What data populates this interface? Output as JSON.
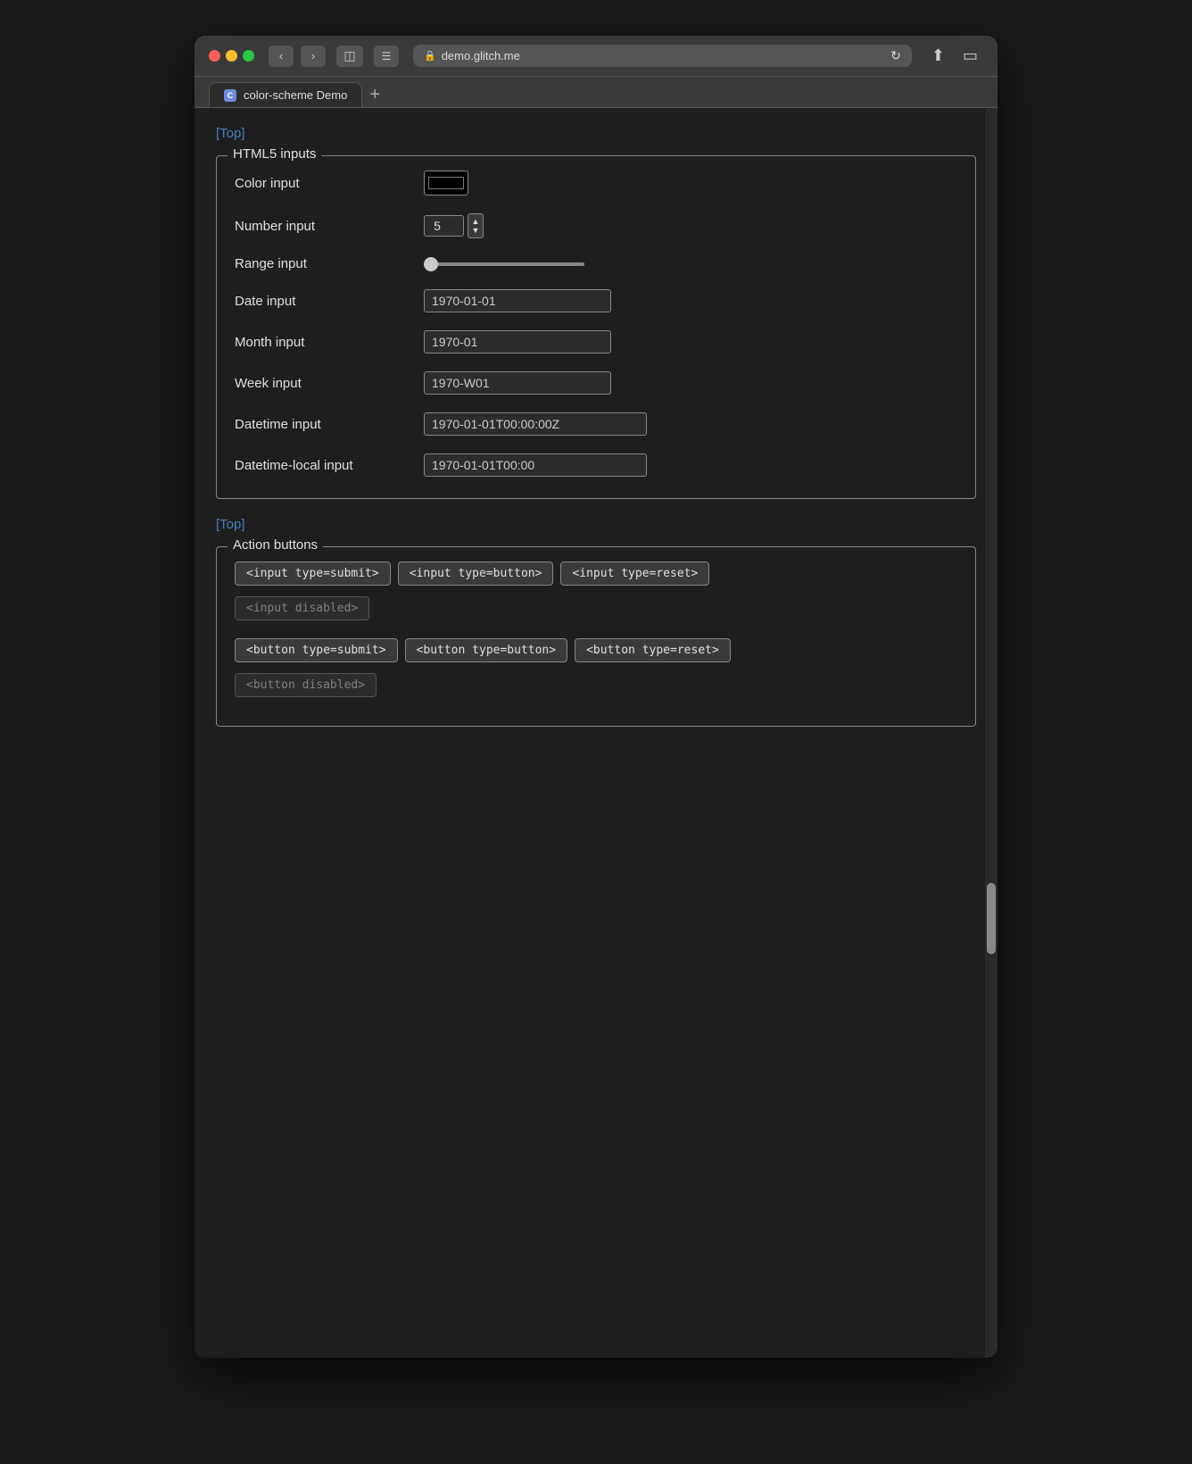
{
  "browser": {
    "url": "demo.glitch.me",
    "tab_title": "color-scheme Demo",
    "tab_favicon": "C"
  },
  "page": {
    "top_link": "[Top]",
    "html5_section": {
      "legend": "HTML5 inputs",
      "fields": [
        {
          "label": "Color input",
          "type": "color",
          "value": "#000000"
        },
        {
          "label": "Number input",
          "type": "number",
          "value": "5"
        },
        {
          "label": "Range input",
          "type": "range",
          "value": "0"
        },
        {
          "label": "Date input",
          "type": "date",
          "value": "1970-01-01"
        },
        {
          "label": "Month input",
          "type": "month",
          "value": "1970-01"
        },
        {
          "label": "Week input",
          "type": "week",
          "value": "1970-W01"
        },
        {
          "label": "Datetime input",
          "type": "datetime",
          "value": "1970-01-01T00:00:00Z"
        },
        {
          "label": "Datetime-local input",
          "type": "datetime-local",
          "value": "1970-01-01T00:00"
        }
      ]
    },
    "bottom_top_link": "[Top]",
    "action_section": {
      "legend": "Action buttons",
      "input_buttons": [
        {
          "label": "<input type=submit>",
          "disabled": false
        },
        {
          "label": "<input type=button>",
          "disabled": false
        },
        {
          "label": "<input type=reset>",
          "disabled": false
        },
        {
          "label": "<input disabled>",
          "disabled": true
        }
      ],
      "button_buttons": [
        {
          "label": "<button type=submit>",
          "disabled": false
        },
        {
          "label": "<button type=button>",
          "disabled": false
        },
        {
          "label": "<button type=reset>",
          "disabled": false
        },
        {
          "label": "<button disabled>",
          "disabled": true
        }
      ]
    }
  }
}
